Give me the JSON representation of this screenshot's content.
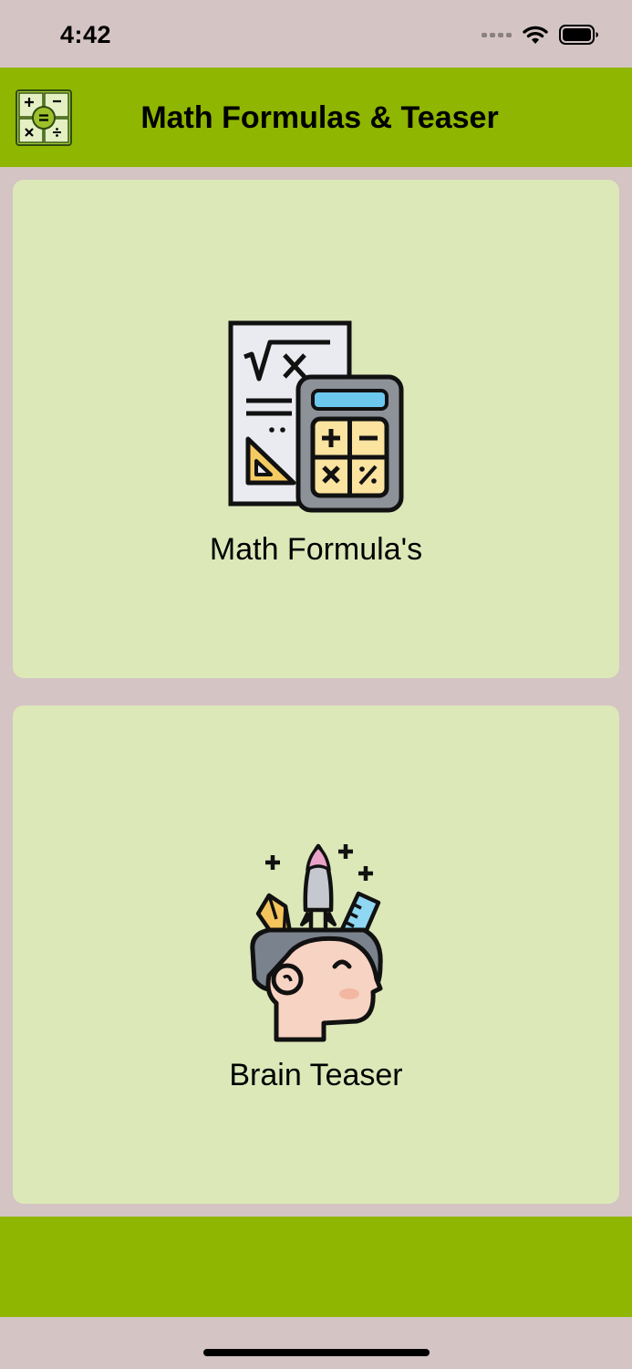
{
  "status_bar": {
    "time": "4:42"
  },
  "header": {
    "title": "Math Formulas & Teaser",
    "logo_icon": "calculator-operators-icon"
  },
  "cards": [
    {
      "label": "Math Formula's",
      "icon": "formula-calculator-icon"
    },
    {
      "label": "Brain Teaser",
      "icon": "creative-head-icon"
    }
  ],
  "colors": {
    "background": "#d4c4c4",
    "accent": "#8fb600",
    "card": "#dce8b8"
  }
}
